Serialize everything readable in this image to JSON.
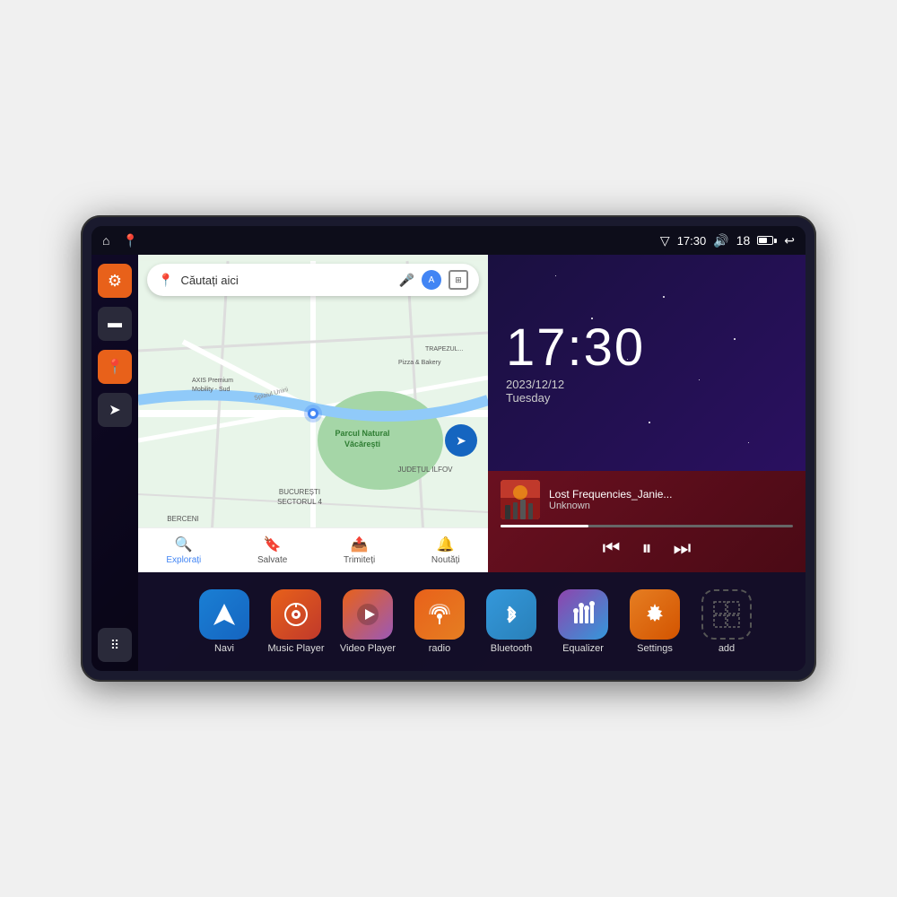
{
  "device": {
    "status_bar": {
      "left_icons": [
        "home-icon",
        "location-icon"
      ],
      "right_items": {
        "wifi_icon": "▼",
        "time": "17:30",
        "volume_icon": "🔊",
        "battery_level": "18",
        "battery_icon": "battery",
        "back_icon": "↩"
      }
    },
    "clock": {
      "time": "17:30",
      "date": "2023/12/12",
      "day": "Tuesday"
    },
    "music": {
      "title": "Lost Frequencies_Janie...",
      "artist": "Unknown",
      "controls": {
        "prev": "⏮",
        "play_pause": "⏸",
        "next": "⏭"
      }
    },
    "map": {
      "search_placeholder": "Căutați aici",
      "locations": [
        "Parcul Natural Văcărești",
        "AXIS Premium Mobility - Sud",
        "Pizza & Bakery",
        "BUCUREȘTI SECTORUL 4",
        "JUDEȚUL ILFOV",
        "BERCENI"
      ],
      "bottom_items": [
        {
          "label": "Explorați",
          "icon": "🔍"
        },
        {
          "label": "Salvate",
          "icon": "🔖"
        },
        {
          "label": "Trimiteți",
          "icon": "📤"
        },
        {
          "label": "Noutăți",
          "icon": "🔔"
        }
      ]
    },
    "sidebar": {
      "buttons": [
        {
          "icon": "⚙",
          "color": "orange",
          "name": "settings"
        },
        {
          "icon": "▬",
          "color": "dark",
          "name": "media"
        },
        {
          "icon": "📍",
          "color": "orange",
          "name": "maps"
        },
        {
          "icon": "➤",
          "color": "dark",
          "name": "navigation"
        },
        {
          "icon": "⋮⋮⋮",
          "color": "dark",
          "name": "grid"
        }
      ]
    },
    "apps": [
      {
        "label": "Navi",
        "icon": "➤",
        "color": "navi"
      },
      {
        "label": "Music Player",
        "icon": "♪",
        "color": "music"
      },
      {
        "label": "Video Player",
        "icon": "▶",
        "color": "video"
      },
      {
        "label": "radio",
        "icon": "📻",
        "color": "radio"
      },
      {
        "label": "Bluetooth",
        "icon": "⚡",
        "color": "bluetooth"
      },
      {
        "label": "Equalizer",
        "icon": "≡",
        "color": "equalizer"
      },
      {
        "label": "Settings",
        "icon": "⚙",
        "color": "settings"
      },
      {
        "label": "add",
        "icon": "+",
        "color": "add"
      }
    ]
  }
}
